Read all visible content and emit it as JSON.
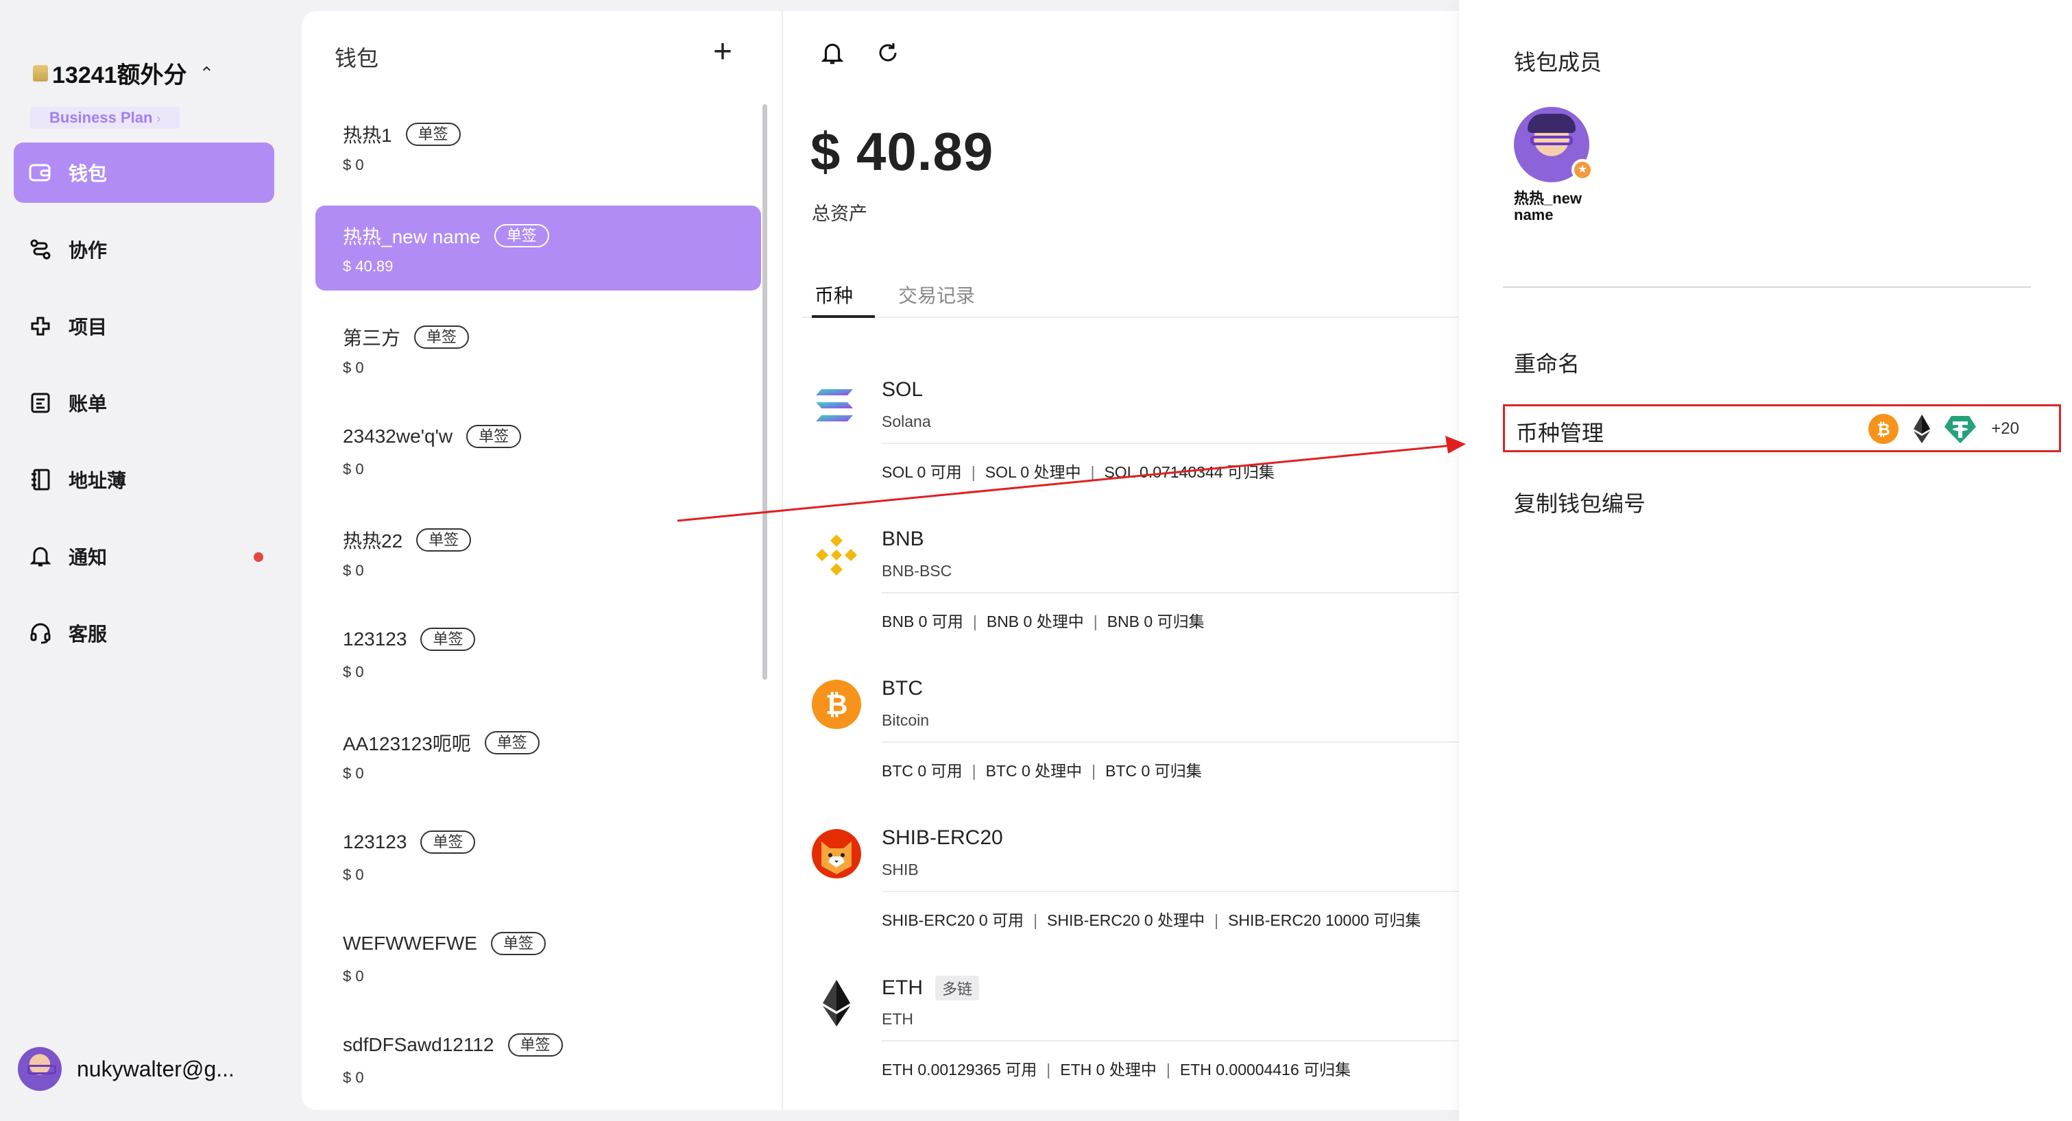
{
  "sidebar": {
    "org_name": "13241额外分",
    "plan_badge": "Business Plan",
    "nav": [
      {
        "label": "钱包",
        "icon": "wallet-icon",
        "active": true
      },
      {
        "label": "协作",
        "icon": "collaborate-icon"
      },
      {
        "label": "项目",
        "icon": "project-icon"
      },
      {
        "label": "账单",
        "icon": "bill-icon"
      },
      {
        "label": "地址薄",
        "icon": "address-book-icon"
      },
      {
        "label": "通知",
        "icon": "bell-icon",
        "has_dot": true
      },
      {
        "label": "客服",
        "icon": "headset-icon"
      }
    ],
    "user_email": "nukywalter@g..."
  },
  "wallet_list": {
    "title": "钱包",
    "items": [
      {
        "name": "热热1",
        "tag": "单签",
        "amount": "$ 0"
      },
      {
        "name": "热热_new name",
        "tag": "单签",
        "amount": "$ 40.89",
        "active": true
      },
      {
        "name": "第三方",
        "tag": "单签",
        "amount": "$ 0"
      },
      {
        "name": "23432we'q'w",
        "tag": "单签",
        "amount": "$ 0"
      },
      {
        "name": "热热22",
        "tag": "单签",
        "amount": "$ 0"
      },
      {
        "name": "123123",
        "tag": "单签",
        "amount": "$ 0"
      },
      {
        "name": "AA123123呃呃",
        "tag": "单签",
        "amount": "$ 0"
      },
      {
        "name": "123123",
        "tag": "单签",
        "amount": "$ 0"
      },
      {
        "name": "WEFWWEFWE",
        "tag": "单签",
        "amount": "$ 0"
      },
      {
        "name": "sdfDFSawd12112",
        "tag": "单签",
        "amount": "$ 0"
      }
    ]
  },
  "main": {
    "total": "$ 40.89",
    "total_label": "总资产",
    "tabs": [
      "币种",
      "交易记录"
    ],
    "coins": [
      {
        "symbol": "SOL",
        "chain": "Solana",
        "bal": [
          "SOL 0 可用",
          "SOL 0 处理中",
          "SOL 0.07140344 可归集"
        ]
      },
      {
        "symbol": "BNB",
        "chain": "BNB-BSC",
        "bal": [
          "BNB 0 可用",
          "BNB 0 处理中",
          "BNB 0 可归集"
        ]
      },
      {
        "symbol": "BTC",
        "chain": "Bitcoin",
        "bal": [
          "BTC 0 可用",
          "BTC 0 处理中",
          "BTC 0 可归集"
        ]
      },
      {
        "symbol": "SHIB-ERC20",
        "chain": "SHIB",
        "bal": [
          "SHIB-ERC20 0 可用",
          "SHIB-ERC20 0 处理中",
          "SHIB-ERC20 10000 可归集"
        ]
      },
      {
        "symbol": "ETH",
        "chain": "ETH",
        "tag": "多链",
        "bal": [
          "ETH 0.00129365 可用",
          "ETH 0 处理中",
          "ETH 0.00004416 可归集"
        ]
      }
    ]
  },
  "right_panel": {
    "members_title": "钱包成员",
    "member_name": "热热_new name",
    "rename": "重命名",
    "coin_management": "币种管理",
    "coin_management_more": "+20",
    "copy_wallet_id": "复制钱包编号"
  },
  "colors": {
    "accent": "#b18cf5",
    "highlight_box": "#d92626",
    "notify_dot": "#e5483c"
  }
}
